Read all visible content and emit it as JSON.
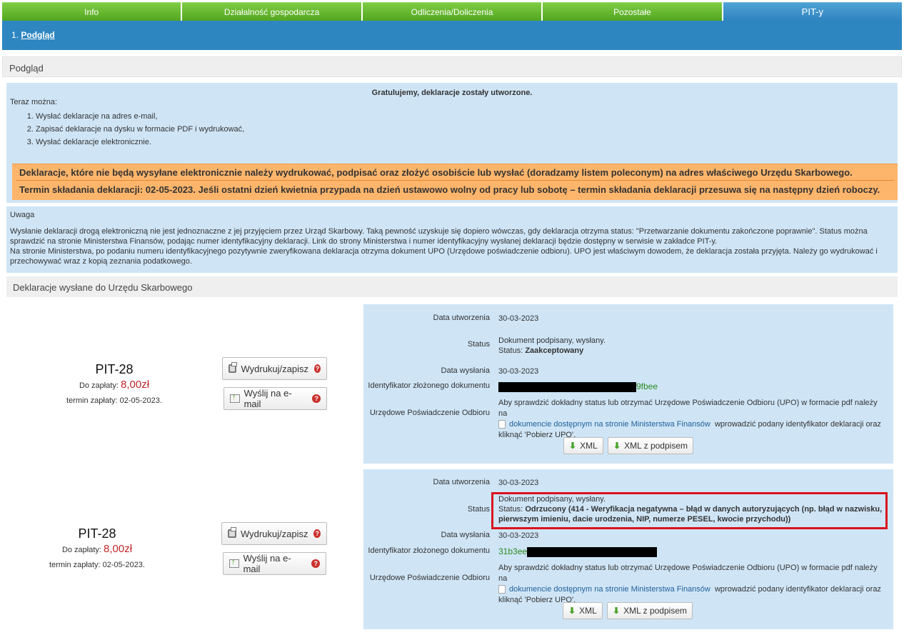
{
  "nav": {
    "tabs": [
      {
        "label": "Info"
      },
      {
        "label": "Działalność gospodarcza"
      },
      {
        "label": "Odliczenia/Doliczenia"
      },
      {
        "label": "Pozostałe"
      },
      {
        "label": "PIT-y"
      }
    ],
    "active_tab": "PIT-y"
  },
  "breadcrumb": {
    "number": "1.",
    "link": "Podgląd"
  },
  "panel_title": "Podgląd",
  "info": {
    "congrats": "Gratulujemy, deklaracje zostały utworzone.",
    "now": "Teraz można:",
    "steps": [
      "Wysłać deklaracje na adres e-mail,",
      "Zapisać deklaracje na dysku w formacie PDF i wydrukować,",
      "Wysłać deklaracje elektronicznie."
    ],
    "warning_1": "Deklaracje, które nie będą wysyłane elektronicznie należy wydrukować, podpisać oraz złożyć osobiście lub wysłać (doradzamy listem poleconym) na adres właściwego Urzędu Skarbowego.",
    "warning_2": "Termin składania deklaracji: 02-05-2023. Jeśli ostatni dzień kwietnia przypada na dzień ustawowo wolny od pracy lub sobotę – termin składania deklaracji przesuwa się na następny dzień roboczy."
  },
  "uwaga": {
    "title": "Uwaga",
    "p1": "Wysłanie deklaracji drogą elektroniczną nie jest jednoznaczne z jej przyjęciem przez Urząd Skarbowy. Taką pewność uzyskuje się dopiero wówczas, gdy deklaracja otrzyma status: \"Przetwarzanie dokumentu zakończone poprawnie\". Status można sprawdzić na stronie Ministerstwa Finansów, podając numer identyfikacyjny deklaracji. Link do strony Ministerstwa i numer identyfikacyjny wysłanej deklaracji będzie dostępny w serwisie w zakładce PIT-y.",
    "p2": "Na stronie Ministerstwa, po podaniu numeru identyfikacyjnego pozytywnie zweryfikowana deklaracja otrzyma dokument UPO (Urzędowe poświadczenie odbioru). UPO jest właściwym dowodem, że deklaracja została przyjęta. Należy go wydrukować i przechowywać wraz z kopią zeznania podatkowego."
  },
  "sent_title": "Deklaracje wysłane do Urzędu Skarbowego",
  "labels": {
    "created": "Data utworzenia",
    "status": "Status",
    "sent": "Data wysłania",
    "identifier": "Identyfikator złożonego dokumentu",
    "upo": "Urzędowe Poświadczenie Odbioru",
    "due_label": "Do zapłaty:",
    "print": "Wydrukuj/zapisz",
    "email": "Wyślij na e-mail",
    "xml": "XML",
    "xml_signed": "XML z podpisem",
    "upo_text_1": "Aby sprawdzić dokładny status lub otrzymać Urzędowe Poświadczenie Odbioru (UPO) w formacie pdf należy na",
    "upo_link": "dokumencie dostępnym na stronie Ministerstwa Finansów",
    "upo_text_2": "wprowadzić podany identyfikator deklaracji oraz",
    "upo_text_3": "kliknąć 'Pobierz UPO'."
  },
  "declarations": [
    {
      "form": "PIT-28",
      "amount": "8,00zł",
      "due_date": "termin zapłaty: 02-05-2023.",
      "created": "30-03-2023",
      "status_line": "Dokument podpisany, wysłany.",
      "status_prefix": "Status:",
      "status_value": "Zaakceptowany",
      "sent": "30-03-2023",
      "identifier_visible": "9fbee"
    },
    {
      "form": "PIT-28",
      "amount": "8,00zł",
      "due_date": "termin zapłaty: 02-05-2023.",
      "created": "30-03-2023",
      "status_line": "Dokument podpisany, wysłany.",
      "status_prefix": "Status:",
      "status_value": "Odrzucony (414 - Weryfikacja negatywna – błąd w danych autoryzujących (np. błąd w nazwisku, pierwszym imieniu, dacie urodzenia, NIP, numerze PESEL, kwocie przychodu))",
      "sent": "30-03-2023",
      "identifier_visible": "31b3ee"
    }
  ],
  "colors": {
    "accent_red": "#d9131f",
    "amount_red": "#c0282a",
    "tab_green": "#52a61f",
    "tab_blue": "#2e86c1"
  }
}
